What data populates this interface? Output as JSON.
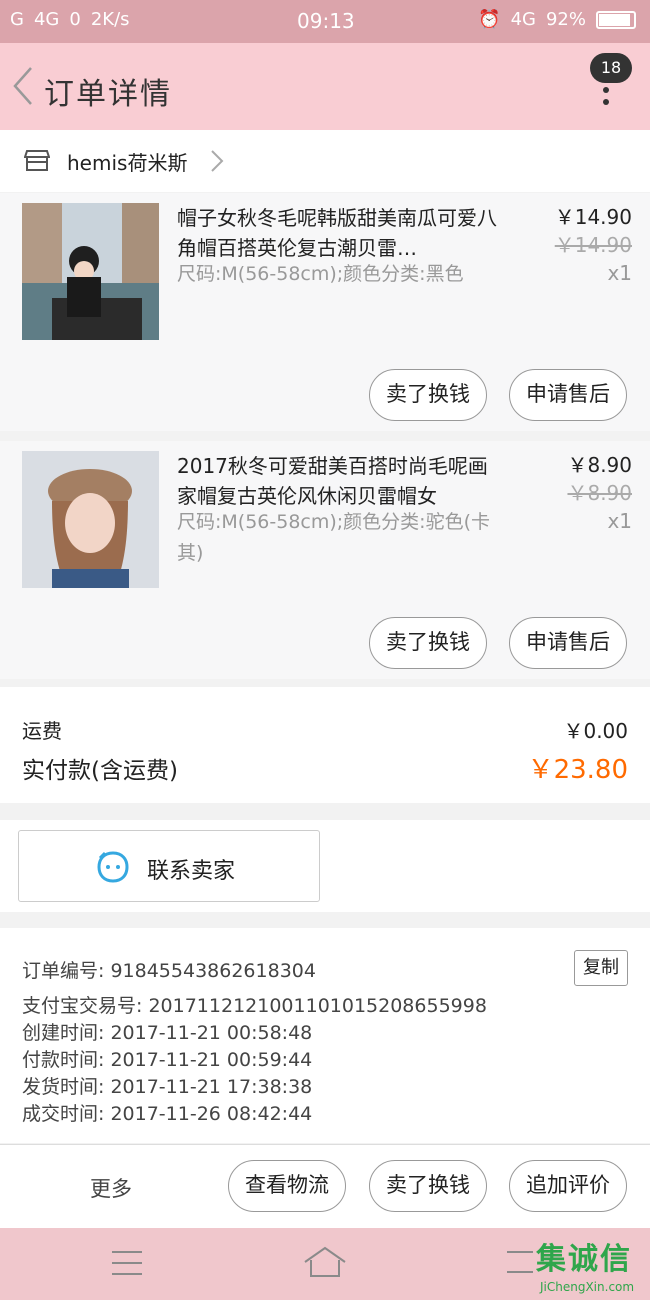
{
  "status_bar": {
    "left": [
      "G",
      "4G",
      "0",
      "2K/s"
    ],
    "time": "09:13",
    "network": "4G",
    "battery": "92%"
  },
  "header": {
    "title": "订单详情",
    "badge_count": "18"
  },
  "shop": {
    "name": "hemis荷米斯"
  },
  "items": [
    {
      "title": "帽子女秋冬毛呢韩版甜美南瓜可爱八角帽百搭英伦复古潮贝雷…",
      "sku": "尺码:M(56-58cm);颜色分类:黑色",
      "price": "￥14.90",
      "original_price": "￥14.90",
      "quantity": "x1",
      "sell_label": "卖了换钱",
      "aftersale_label": "申请售后"
    },
    {
      "title": "2017秋冬可爱甜美百搭时尚毛呢画家帽复古英伦风休闲贝雷帽女",
      "sku": "尺码:M(56-58cm);颜色分类:驼色(卡其)",
      "price": "￥8.90",
      "original_price": "￥8.90",
      "quantity": "x1",
      "sell_label": "卖了换钱",
      "aftersale_label": "申请售后"
    }
  ],
  "totals": {
    "shipping_label": "运费",
    "shipping_value": "￥0.00",
    "paid_label": "实付款(含运费)",
    "paid_value": "￥23.80"
  },
  "contact": {
    "label": "联系卖家"
  },
  "order_info": {
    "order_no_label": "订单编号:",
    "order_no": "918455438626183​04",
    "copy_label": "复制",
    "alipay_label": "支付宝交易号:",
    "alipay_no": "2017112121001101015208655998",
    "created_label": "创建时间:",
    "created": "2017-11-21 00:58:48",
    "paid_label": "付款时间:",
    "paid": "2017-11-21 00:59:44",
    "shipped_label": "发货时间:",
    "shipped": "2017-11-21 17:38:38",
    "closed_label": "成交时间:",
    "closed": "2017-11-26 08:42:44"
  },
  "bottom_actions": {
    "more": "更多",
    "logistics": "查看物流",
    "sell": "卖了换钱",
    "review": "追加评价"
  },
  "watermark": {
    "main": "集诚信",
    "sub": "JiChengXin.com"
  },
  "colors": {
    "header_bg": "#f9cdd3",
    "status_bg": "#dba4ab",
    "accent_price": "#ff6a00",
    "nav_bg": "#f0c7cc"
  }
}
